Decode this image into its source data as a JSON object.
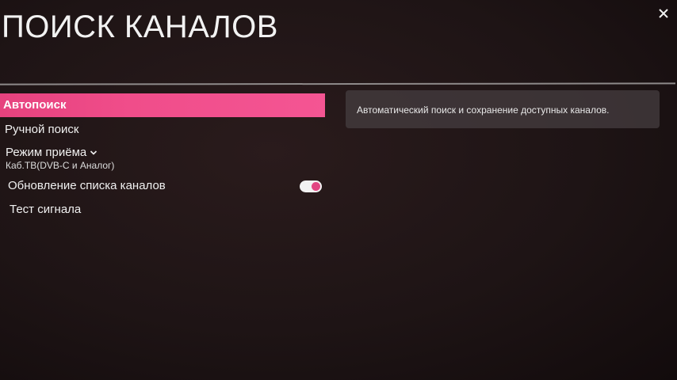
{
  "header": {
    "title": "ПОИСК КАНАЛОВ",
    "close_icon": "close-icon"
  },
  "menu": {
    "items": [
      {
        "label": "Автопоиск",
        "active": true
      },
      {
        "label": "Ручной поиск"
      },
      {
        "label": "Режим приёма",
        "value": "Каб.ТВ(DVB-C и Аналог)",
        "icon": "chevron-down-icon"
      },
      {
        "label": "Обновление списка каналов",
        "toggle_on": true
      },
      {
        "label": "Тест сигнала"
      }
    ]
  },
  "info": {
    "description": "Автоматический поиск и сохранение доступных каналов."
  },
  "colors": {
    "accent": "#f04d8a",
    "toggle_knob": "#e24582",
    "background": "#1e1415"
  }
}
